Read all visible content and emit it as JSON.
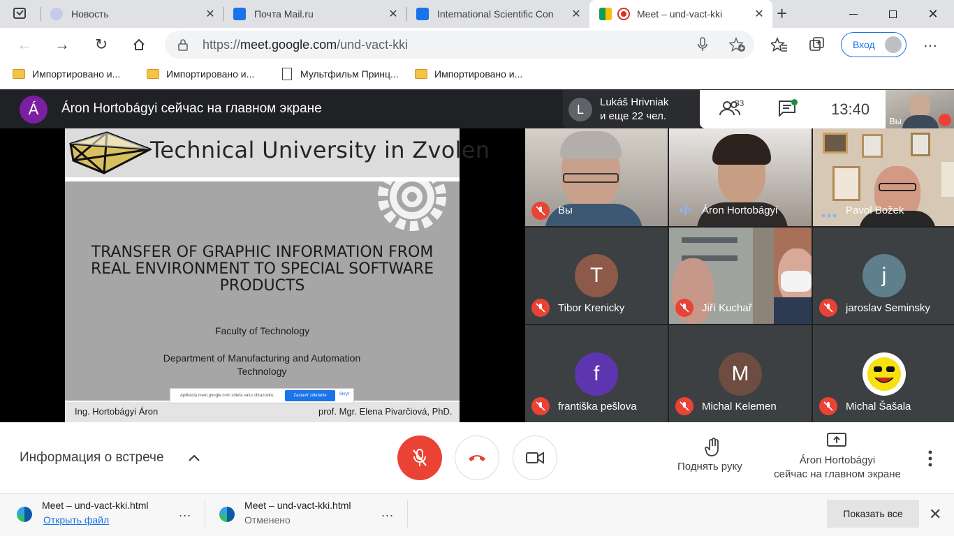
{
  "browser": {
    "tabs": [
      {
        "title": "Новость",
        "favicon_color": "#c5cae9"
      },
      {
        "title": "Почта Mail.ru",
        "favicon_color": "#1a73e8"
      },
      {
        "title": "International Scientific Con",
        "favicon_color": "#1a73e8"
      },
      {
        "title": "Meet – und-vact-kki",
        "favicon_color": "#0f9d58"
      }
    ],
    "new_tab": "+",
    "close_glyph": "✕",
    "url_prefix": "https://",
    "url_host": "meet.google.com",
    "url_path": "/und-vact-kki",
    "signin_label": "Вход",
    "bookmarks": [
      {
        "label": "Импортировано и...",
        "kind": "folder"
      },
      {
        "label": "Импортировано и...",
        "kind": "folder"
      },
      {
        "label": "Мультфильм Принц...",
        "kind": "page"
      },
      {
        "label": "Импортировано и...",
        "kind": "folder"
      }
    ]
  },
  "meet": {
    "presenter_initial": "Á",
    "presenter_title": "Áron Hortobágyi сейчас на главном экране",
    "active_speaker_initial": "L",
    "active_speaker_line1": "Lukáš Hrivniak",
    "active_speaker_line2": "и еще 22 чел.",
    "participants_count": "33",
    "clock": "13:40",
    "self_label": "Вы",
    "slide": {
      "university": "Technical University in Zvolen",
      "title": "TRANSFER OF GRAPHIC INFORMATION FROM REAL ENVIRONMENT TO SPECIAL SOFTWARE PRODUCTS",
      "faculty": "Faculty of Technology",
      "department": "Department of Manufacturing and Automation Technology",
      "author": "Ing. Hortobágyi Áron",
      "supervisor": "prof. Mgr. Elena Pivarčiová, PhD.",
      "share_notice": "Aplikácia meet.google.com zdieľa vašu obrazovku.",
      "share_stop": "Zastaviť zdieľanie",
      "share_hide": "Skryť"
    },
    "tiles": [
      {
        "name": "Вы",
        "initial": "",
        "color": "#8a8580",
        "muted": true
      },
      {
        "name": "Áron Hortobágyi",
        "initial": "",
        "color": "#5a4c42",
        "muted": false
      },
      {
        "name": "Pavol Božek",
        "initial": "",
        "color": "#b9a894",
        "muted": false
      },
      {
        "name": "Tibor Krenicky",
        "initial": "T",
        "color": "#8d5a4a",
        "muted": true
      },
      {
        "name": "Jiří Kuchař",
        "initial": "",
        "color": "#7a7060",
        "muted": true
      },
      {
        "name": "jaroslav Seminsky",
        "initial": "j",
        "color": "#5f7f8d",
        "muted": true
      },
      {
        "name": "františka pešlova",
        "initial": "f",
        "color": "#5e35b1",
        "muted": true
      },
      {
        "name": "Michal Kelemen",
        "initial": "M",
        "color": "#6d4c41",
        "muted": true
      },
      {
        "name": "Michal Šašala",
        "initial": "",
        "color": "#ffffff",
        "muted": true
      }
    ],
    "meeting_info_label": "Информация о встрече",
    "raise_hand_label": "Поднять руку",
    "presenting_label_1": "Áron Hortobágyi",
    "presenting_label_2": "сейчас на главном экране",
    "colors": {
      "mute_red": "#ea4335",
      "accent_blue": "#1a73e8"
    }
  },
  "downloads": [
    {
      "name": "Meet – und-vact-kki.html",
      "status": "Открыть файл",
      "status_color": "#1a73e8"
    },
    {
      "name": "Meet – und-vact-kki.html",
      "status": "Отменено",
      "status_color": "#5f6368"
    }
  ],
  "download_more": "...",
  "show_all_label": "Показать все"
}
